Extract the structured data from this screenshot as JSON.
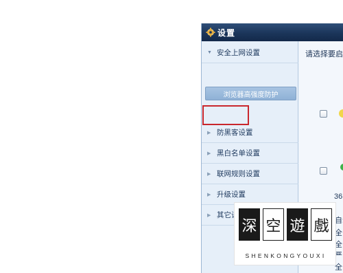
{
  "window": {
    "title": "设置",
    "icon": "gear-icon"
  },
  "sidebar": {
    "items": [
      {
        "label": "安全上网设置",
        "state": "expanded"
      },
      {
        "label": "防黑客设置",
        "state": "collapsed"
      },
      {
        "label": "黑白名单设置",
        "state": "collapsed"
      },
      {
        "label": "联网规则设置",
        "state": "collapsed"
      },
      {
        "label": "升级设置",
        "state": "collapsed"
      },
      {
        "label": "其它设置",
        "state": "collapsed"
      }
    ],
    "sub_button": "浏览器高强度防护"
  },
  "content": {
    "prompt": "请选择要启",
    "text_360": "36",
    "fragments": [
      "自动",
      "全",
      "全",
      "严",
      "全",
      "全"
    ]
  },
  "watermark": {
    "chars": [
      "深",
      "空",
      "遊",
      "戲"
    ],
    "subtitle": "SHENKONGYOUXI"
  },
  "colors": {
    "titlebar": "#1b355a",
    "highlight": "#c9262c",
    "sidebar_bg": "#e6eff9",
    "button": "#8fb1d6"
  }
}
